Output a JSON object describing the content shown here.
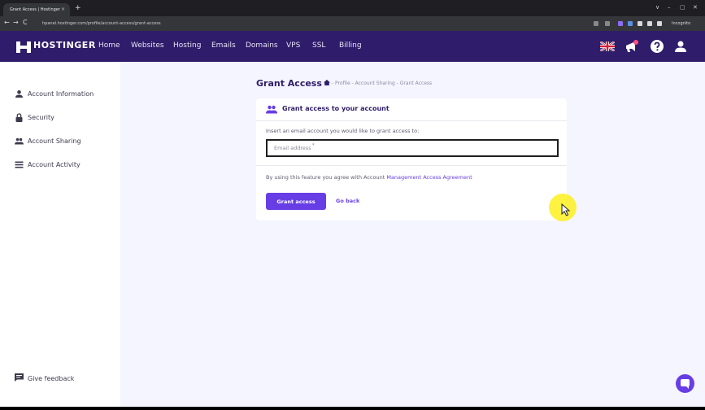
{
  "browser": {
    "tab_title": "Grant Access | Hostinger",
    "tab_close": "×",
    "new_tab": "+",
    "url": "hpanel.hostinger.com/profile/account-access/grant-access",
    "incognito_label": "Incognito",
    "window_controls": [
      "∨",
      "–",
      "▢",
      "✕"
    ],
    "nav": [
      "←",
      "→",
      "C"
    ]
  },
  "header": {
    "logo_text": "HOSTINGER",
    "nav_items": [
      "Home",
      "Websites",
      "Hosting",
      "Emails",
      "Domains",
      "VPS",
      "SSL",
      "Billing"
    ],
    "icons": [
      "uk-flag-icon",
      "megaphone-icon",
      "help-icon",
      "user-icon"
    ],
    "brand_color": "#2f1c6a",
    "accent_color": "#673de6"
  },
  "sidebar": {
    "items": [
      {
        "label": "Account Information",
        "icon": "user-icon"
      },
      {
        "label": "Security",
        "icon": "lock-icon"
      },
      {
        "label": "Account Sharing",
        "icon": "users-icon"
      },
      {
        "label": "Account Activity",
        "icon": "list-icon"
      }
    ],
    "feedback_label": "Give feedback"
  },
  "page": {
    "title": "Grant Access",
    "breadcrumb": "- Profile - Account Sharing - Grant Access"
  },
  "card": {
    "title": "Grant access to your account",
    "instruction": "Insert an email account you would like to grant access to:",
    "email_placeholder": "Email address",
    "email_required_mark": "*",
    "agreement_prefix": "By using this feature you agree with Account ",
    "agreement_link": "Management Access Agreement",
    "grant_button": "Grant access",
    "back_link": "Go back"
  }
}
